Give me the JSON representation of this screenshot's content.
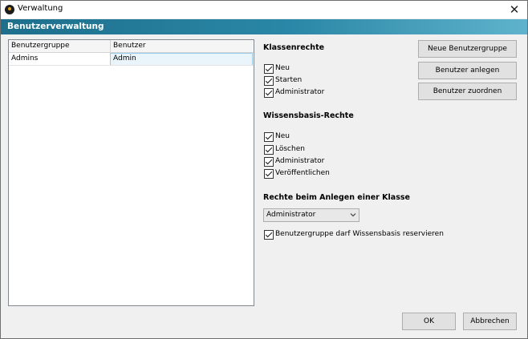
{
  "window": {
    "title": "Verwaltung"
  },
  "header": {
    "title": "Benutzerverwaltung"
  },
  "table": {
    "columns": [
      "Benutzergruppe",
      "Benutzer"
    ],
    "rows": [
      {
        "group": "Admins",
        "user": "Admin"
      }
    ]
  },
  "class_rights": {
    "title": "Klassenrechte",
    "items": [
      {
        "label": "Neu",
        "checked": true
      },
      {
        "label": "Starten",
        "checked": true
      },
      {
        "label": "Administrator",
        "checked": true
      }
    ]
  },
  "kb_rights": {
    "title": "Wissensbasis-Rechte",
    "items": [
      {
        "label": "Neu",
        "checked": true
      },
      {
        "label": "Löschen",
        "checked": true
      },
      {
        "label": "Administrator",
        "checked": true
      },
      {
        "label": "Veröffentlichen",
        "checked": true
      }
    ]
  },
  "create_rights": {
    "title": "Rechte beim Anlegen einer Klasse",
    "selected": "Administrator"
  },
  "reserve": {
    "label": "Benutzergruppe darf Wissensbasis reservieren",
    "checked": true
  },
  "buttons": {
    "new_group": "Neue Benutzergruppe",
    "create_user": "Benutzer anlegen",
    "assign_user": "Benutzer zuordnen",
    "ok": "OK",
    "cancel": "Abbrechen"
  },
  "icons": {
    "app": "app-logo-icon",
    "close": "close-icon",
    "dropdown": "chevron-down-icon",
    "check": "checkmark-icon"
  }
}
